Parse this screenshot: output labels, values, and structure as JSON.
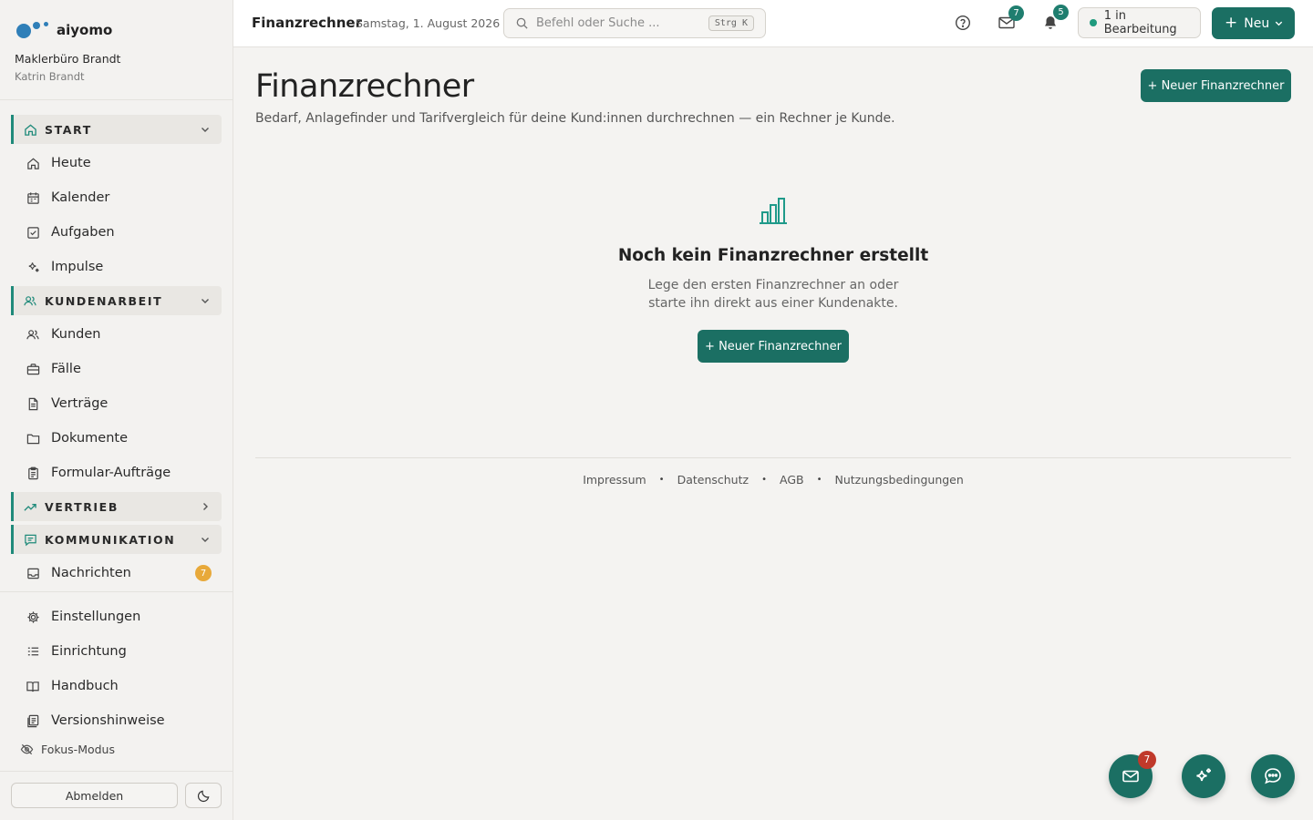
{
  "brand": {
    "name": "aiyomo",
    "org": "Maklerbüro Brandt",
    "user": "Katrin Brandt"
  },
  "sidebar": {
    "sections": [
      {
        "label": "START",
        "icon": "home-icon",
        "expanded": true,
        "items": [
          {
            "label": "Heute",
            "icon": "home-icon"
          },
          {
            "label": "Kalender",
            "icon": "calendar-icon"
          },
          {
            "label": "Aufgaben",
            "icon": "checkbox-icon"
          },
          {
            "label": "Impulse",
            "icon": "sparkle-icon"
          }
        ]
      },
      {
        "label": "KUNDENARBEIT",
        "icon": "users-icon",
        "expanded": true,
        "items": [
          {
            "label": "Kunden",
            "icon": "users-icon"
          },
          {
            "label": "Fälle",
            "icon": "briefcase-icon"
          },
          {
            "label": "Verträge",
            "icon": "document-icon"
          },
          {
            "label": "Dokumente",
            "icon": "folder-icon"
          },
          {
            "label": "Formular-Aufträge",
            "icon": "clipboard-icon"
          }
        ]
      },
      {
        "label": "VERTRIEB",
        "icon": "trending-up-icon",
        "expanded": false,
        "items": []
      },
      {
        "label": "KOMMUNIKATION",
        "icon": "message-icon",
        "expanded": true,
        "items": [
          {
            "label": "Nachrichten",
            "icon": "inbox-icon",
            "badge": "7"
          }
        ]
      }
    ],
    "bottom_items": [
      {
        "label": "Einstellungen",
        "icon": "gear-icon"
      },
      {
        "label": "Einrichtung",
        "icon": "list-icon"
      },
      {
        "label": "Handbuch",
        "icon": "book-icon"
      },
      {
        "label": "Versionshinweise",
        "icon": "notes-icon"
      }
    ],
    "focus_mode": "Fokus-Modus",
    "logout": "Abmelden"
  },
  "header": {
    "title": "Finanzrechner",
    "date": "Samstag, 1. August 2026",
    "search_placeholder": "Befehl oder Suche ...",
    "search_shortcut": "Strg K",
    "mail_badge": "7",
    "notification_badge": "5",
    "status": "1 in Bearbeitung",
    "new_button": "Neu"
  },
  "main": {
    "title": "Finanzrechner",
    "subtitle": "Bedarf, Anlagefinder und Tarifvergleich für deine Kund:innen durchrechnen — ein Rechner je Kunde.",
    "primary_button": "+ Neuer Finanzrechner",
    "empty": {
      "title": "Noch kein Finanzrechner erstellt",
      "text_line1": "Lege den ersten Finanzrechner an oder",
      "text_line2": "starte ihn direkt aus einer Kundenakte.",
      "button": "+ Neuer Finanzrechner"
    }
  },
  "footer": {
    "links": [
      "Impressum",
      "Datenschutz",
      "AGB",
      "Nutzungsbedingungen"
    ]
  },
  "fabs": {
    "mail_badge": "7"
  },
  "colors": {
    "accent": "#1b6f63",
    "accent_light": "#1f9a8a",
    "badge_orange": "#e8a93a",
    "badge_red": "#c0392b"
  }
}
